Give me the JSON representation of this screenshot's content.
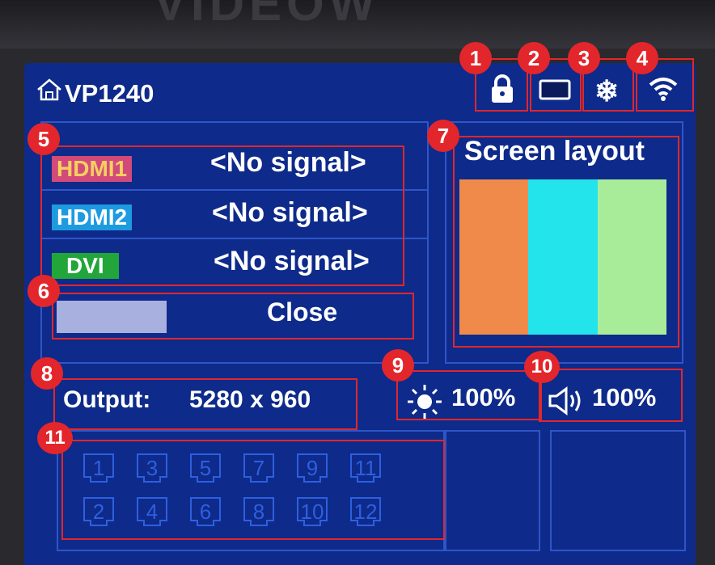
{
  "header": {
    "device_name": "VP1240",
    "icons": [
      "home-icon",
      "lock-icon",
      "display-icon",
      "snowflake-icon",
      "wifi-icon"
    ]
  },
  "markers": [
    "1",
    "2",
    "3",
    "4",
    "5",
    "6",
    "7",
    "8",
    "9",
    "10",
    "11"
  ],
  "sources": [
    {
      "name": "HDMI1",
      "status": "<No signal>",
      "color": "#d24a7a"
    },
    {
      "name": "HDMI2",
      "status": "<No signal>",
      "color": "#1e9be0"
    },
    {
      "name": "DVI",
      "status": "<No signal>",
      "color": "#22a63a"
    }
  ],
  "close": {
    "label": "Close",
    "swatch_color": "#a8b0e0"
  },
  "layout": {
    "title": "Screen layout",
    "panel_colors": [
      "#f08a4a",
      "#22e4ea",
      "#a8ec9a"
    ]
  },
  "output": {
    "label": "Output:",
    "value": "5280 x 960"
  },
  "brightness": {
    "value": "100%",
    "icon": "sun-icon"
  },
  "volume": {
    "value": "100%",
    "icon": "speaker-icon"
  },
  "ports": [
    "1",
    "3",
    "5",
    "7",
    "9",
    "11",
    "2",
    "4",
    "6",
    "8",
    "10",
    "12"
  ],
  "colors": {
    "screen_bg": "#0e2a8a",
    "annotation_red": "#e3262b",
    "panel_border": "#2e56c8"
  }
}
